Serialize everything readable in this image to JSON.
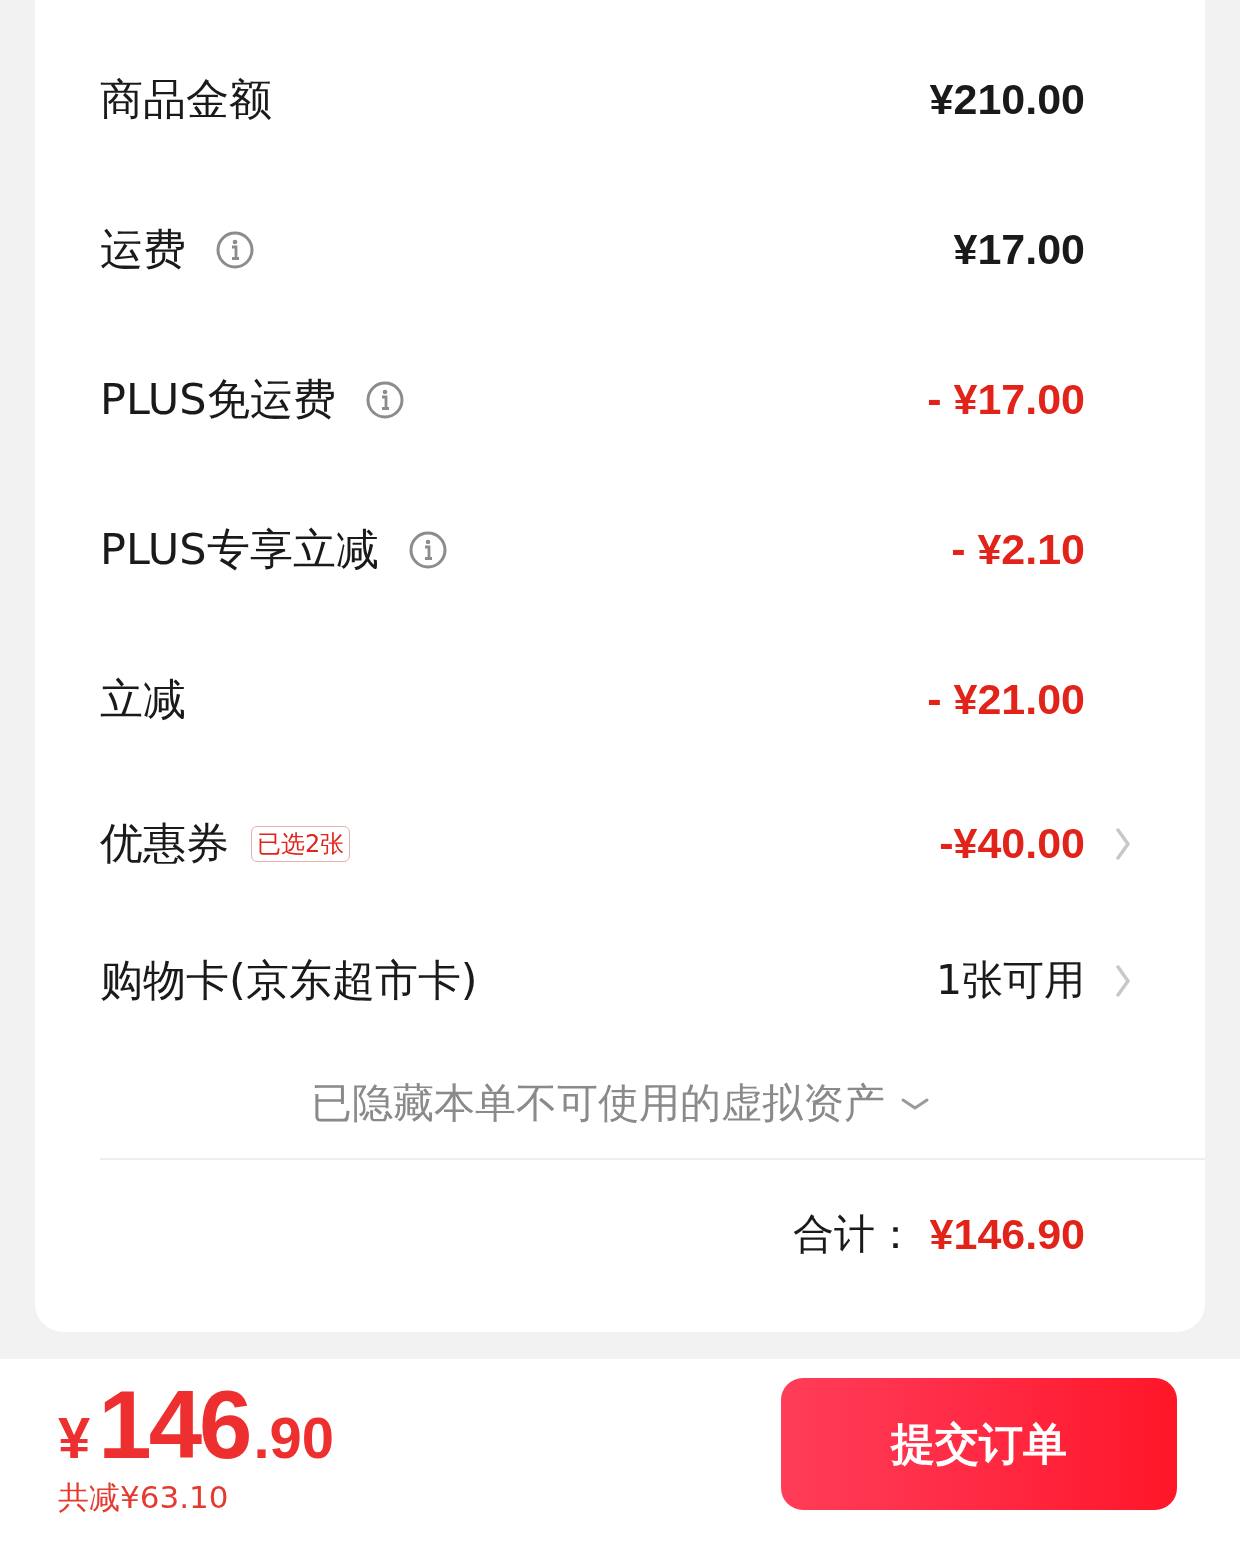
{
  "summary": {
    "rows": [
      {
        "kind": "amount",
        "label": "商品金额",
        "info": false,
        "value": "¥210.00",
        "discount": false,
        "link": false
      },
      {
        "kind": "amount",
        "label": "运费",
        "info": true,
        "value": "¥17.00",
        "discount": false,
        "link": false
      },
      {
        "kind": "amount",
        "label": "PLUS免运费",
        "info": true,
        "value": "- ¥17.00",
        "discount": true,
        "link": false
      },
      {
        "kind": "amount",
        "label": "PLUS专享立减",
        "info": true,
        "value": "- ¥2.10",
        "discount": true,
        "link": false
      },
      {
        "kind": "amount",
        "label": "立减",
        "info": false,
        "value": "- ¥21.00",
        "discount": true,
        "link": false
      },
      {
        "kind": "amount",
        "label": "优惠券",
        "info": false,
        "badge": "已选2张",
        "value": "-¥40.00",
        "discount": true,
        "link": true
      },
      {
        "kind": "text",
        "label": "购物卡(京东超市卡)",
        "info": false,
        "value": "1张可用",
        "discount": false,
        "link": true
      }
    ],
    "hidden_note": {
      "text": "已隐藏本单不可使用的虚拟资产",
      "expanded": false
    },
    "total": {
      "label": "合计：",
      "value": "¥146.90"
    }
  },
  "checkout_bar": {
    "price": {
      "currency": "¥",
      "integer": "146",
      "decimal": ".90"
    },
    "savings": "共减¥63.10",
    "submit_button": "提交订单"
  }
}
